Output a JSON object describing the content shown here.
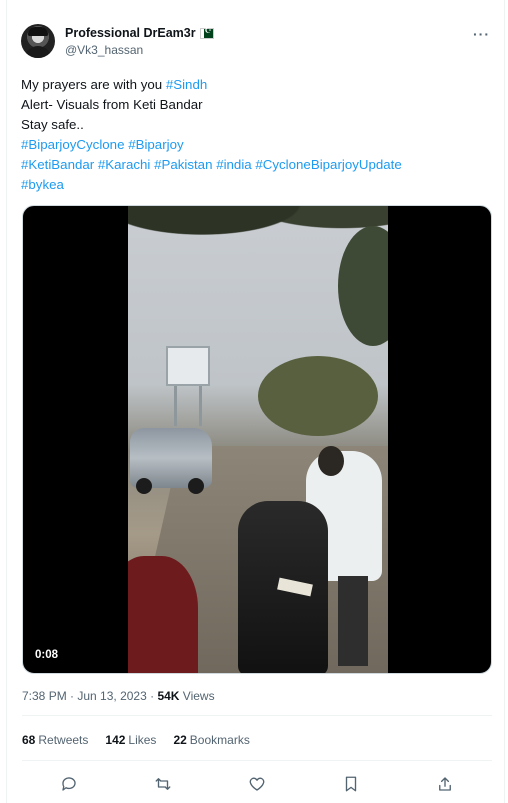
{
  "author": {
    "display_name": "Professional DrEam3r",
    "handle": "@Vk3_hassan",
    "flag_icon": "pakistan-flag-icon"
  },
  "menu": {
    "more_label": "···"
  },
  "tweet": {
    "line1_text": "My prayers are with you ",
    "line1_tag": "#Sindh",
    "line2": "Alert- Visuals from Keti Bandar",
    "line3": "Stay safe..",
    "tags_line4": [
      "#BiparjoyCyclone",
      "#Biparjoy"
    ],
    "tags_line5": [
      "#KetiBandar",
      "#Karachi",
      "#Pakistan",
      "#india",
      "#CycloneBiparjoyUpdate"
    ],
    "tags_line6": [
      "#bykea"
    ],
    "tag_color": "#1d9bf0"
  },
  "video": {
    "duration": "0:08"
  },
  "meta": {
    "time": "7:38 PM",
    "separator": " · ",
    "date": "Jun 13, 2023",
    "views_count": "54K",
    "views_label": " Views"
  },
  "stats": {
    "retweets_count": "68",
    "retweets_label": "Retweets",
    "likes_count": "142",
    "likes_label": "Likes",
    "bookmarks_count": "22",
    "bookmarks_label": "Bookmarks"
  },
  "actions": [
    "reply-icon",
    "retweet-icon",
    "like-icon",
    "bookmark-icon",
    "share-icon"
  ]
}
